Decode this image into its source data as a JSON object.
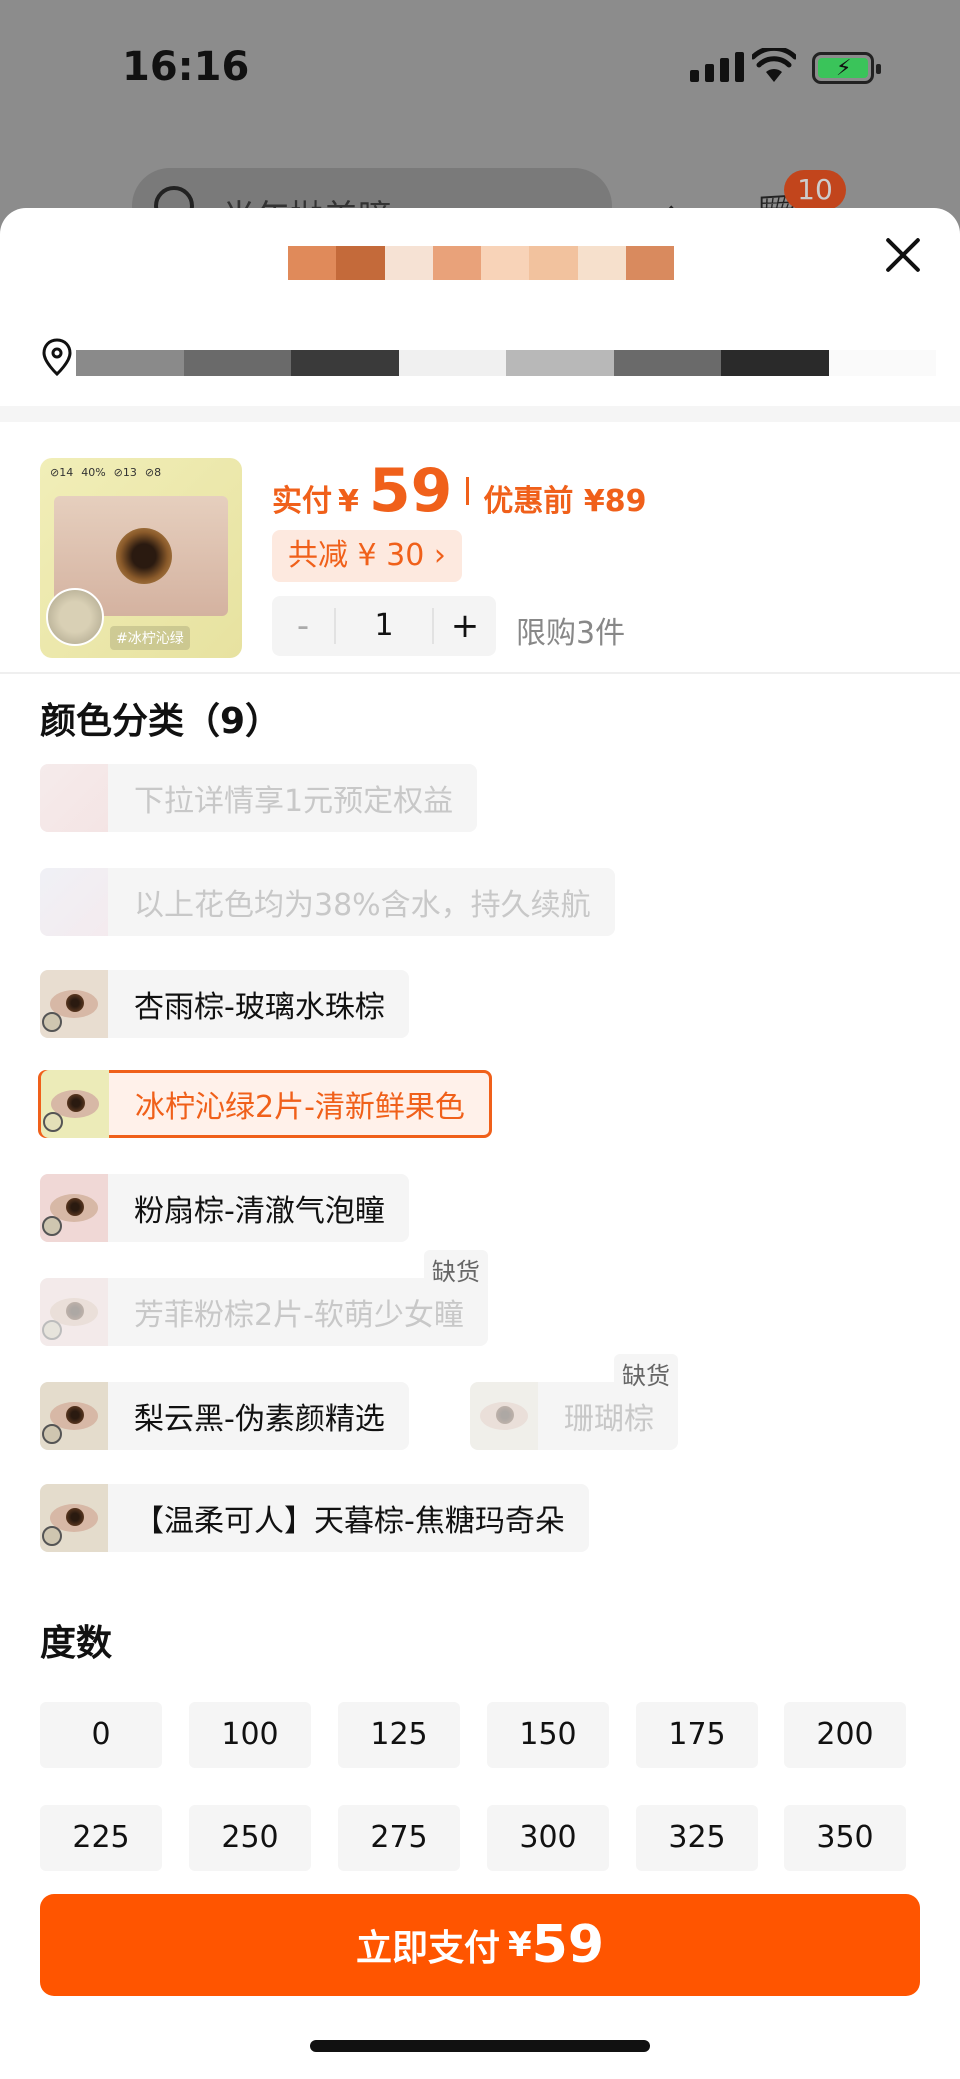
{
  "status_bar": {
    "time": "16:16"
  },
  "background": {
    "search_placeholder": "半年抛美瞳",
    "cart_badge": "10"
  },
  "product": {
    "price_label": "实付",
    "currency": "¥",
    "price": "59",
    "original_label": "优惠前 ¥89",
    "discount": "共减 ¥ 30 ›",
    "quantity": "1",
    "minus": "-",
    "plus": "+",
    "limit": "限购3件",
    "thumb_caption": "#冰柠沁绿"
  },
  "color_section": {
    "title": "颜色分类（9）",
    "options": [
      {
        "label": "下拉详情享1元预定权益",
        "state": "disabled"
      },
      {
        "label": "以上花色均为38%含水，持久续航",
        "state": "disabled"
      },
      {
        "label": "杏雨棕-玻璃水珠棕",
        "state": "normal"
      },
      {
        "label": "冰柠沁绿2片-清新鲜果色",
        "state": "selected"
      },
      {
        "label": "粉扇棕-清澈气泡瞳",
        "state": "normal"
      },
      {
        "label": "芳菲粉棕2片-软萌少女瞳",
        "state": "disabled",
        "badge": "缺货"
      },
      {
        "label": "梨云黑-伪素颜精选",
        "state": "normal"
      },
      {
        "label": "珊瑚棕",
        "state": "disabled",
        "badge": "缺货"
      },
      {
        "label": "【温柔可人】天暮棕-焦糖玛奇朵",
        "state": "normal"
      }
    ]
  },
  "degree_section": {
    "title": "度数",
    "values": [
      "0",
      "100",
      "125",
      "150",
      "175",
      "200",
      "225",
      "250",
      "275",
      "300",
      "325",
      "350"
    ]
  },
  "pay_button": {
    "label": "立即支付",
    "currency": "¥",
    "amount": "59"
  },
  "colors": {
    "accent": "#f0601a",
    "pay": "#ff5500"
  }
}
